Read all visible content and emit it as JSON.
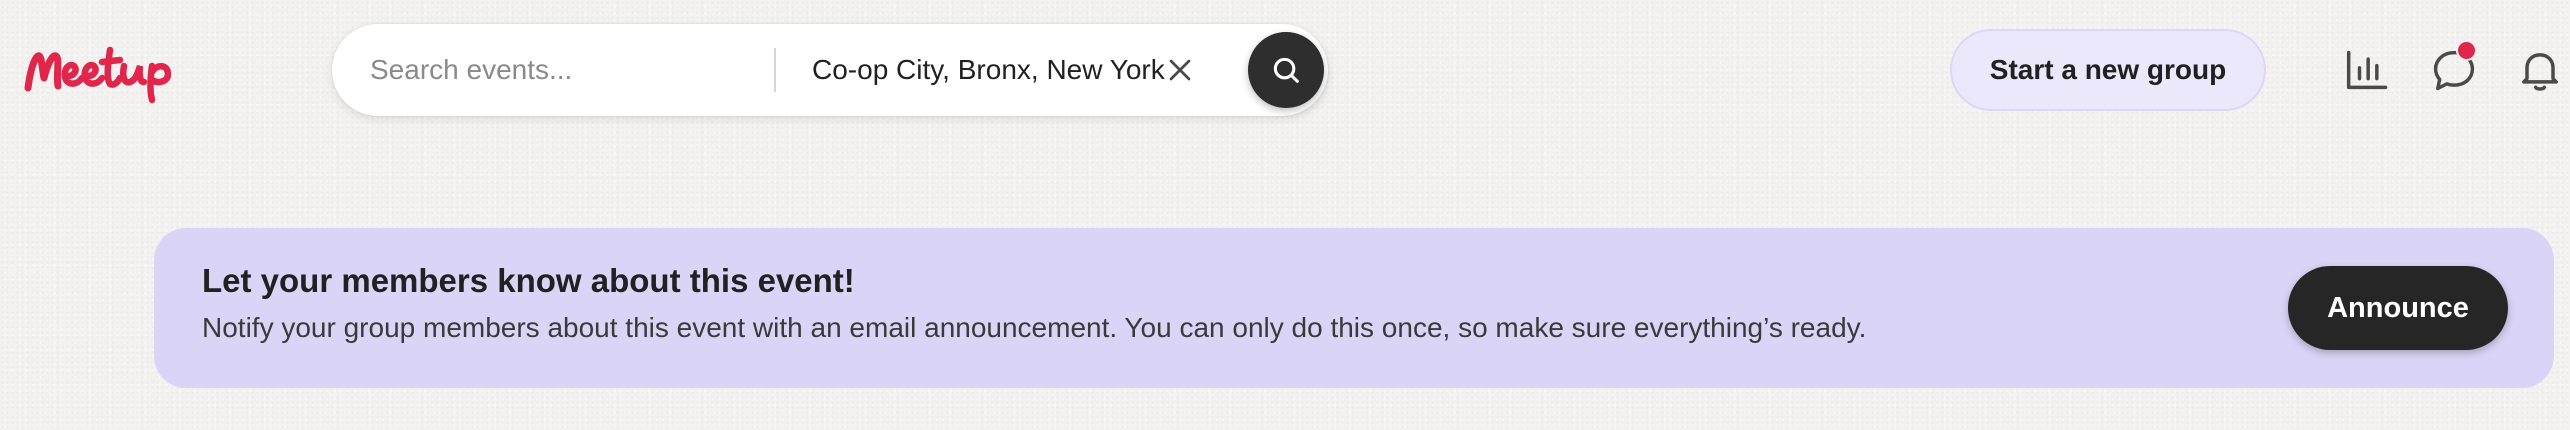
{
  "header": {
    "logo_text": "Meetup",
    "search": {
      "placeholder": "Search events...",
      "value": "",
      "location": "Co-op City, Bronx, New York"
    },
    "start_group_label": "Start a new group",
    "icons": {
      "clear": "close-icon",
      "search": "search-icon",
      "insights": "bar-chart-icon",
      "messages": "chat-bubble-icon",
      "notifications": "bell-icon"
    },
    "messages_has_unread": true
  },
  "banner": {
    "title": "Let your members know about this event!",
    "body": "Notify your group members about this event with an email announcement. You can only do this once, so make sure everything’s ready.",
    "button_label": "Announce"
  },
  "colors": {
    "brand": "#e0264b",
    "banner_bg": "#dad5f7",
    "start_group_bg": "#ece8fc",
    "dark_button": "#262626",
    "page_bg": "#f3f2f1"
  }
}
